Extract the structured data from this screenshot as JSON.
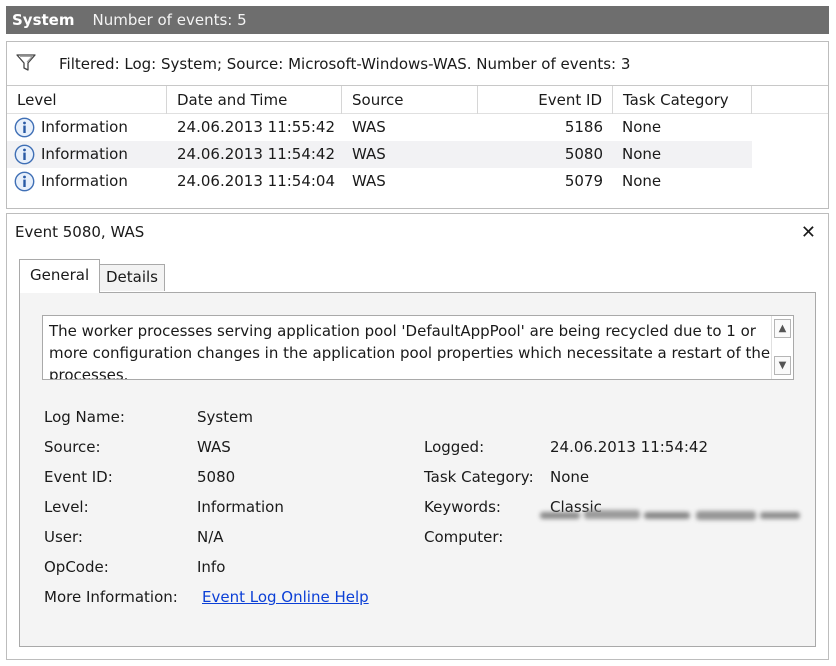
{
  "header": {
    "title": "System",
    "event_count": "Number of events: 5"
  },
  "filter": {
    "text": "Filtered: Log: System; Source: Microsoft-Windows-WAS. Number of events: 3",
    "icon": "filter-icon"
  },
  "table": {
    "columns": [
      "Level",
      "Date and Time",
      "Source",
      "Event ID",
      "Task Category"
    ],
    "rows": [
      {
        "level": "Information",
        "datetime": "24.06.2013 11:55:42",
        "source": "WAS",
        "event_id": "5186",
        "task_category": "None"
      },
      {
        "level": "Information",
        "datetime": "24.06.2013 11:54:42",
        "source": "WAS",
        "event_id": "5080",
        "task_category": "None"
      },
      {
        "level": "Information",
        "datetime": "24.06.2013 11:54:04",
        "source": "WAS",
        "event_id": "5079",
        "task_category": "None"
      }
    ]
  },
  "event": {
    "title": "Event 5080, WAS",
    "tabs": [
      "General",
      "Details"
    ],
    "description": "The worker processes serving application pool 'DefaultAppPool' are being recycled due to 1 or more configuration changes in the application pool properties which necessitate a restart of the processes.",
    "labels": {
      "log_name": "Log Name:",
      "source": "Source:",
      "event_id": "Event ID:",
      "level": "Level:",
      "user": "User:",
      "opcode": "OpCode:",
      "more_info": "More Information:",
      "logged": "Logged:",
      "task_category": "Task Category:",
      "keywords": "Keywords:",
      "computer": "Computer:"
    },
    "values": {
      "log_name": "System",
      "source": "WAS",
      "event_id": "5080",
      "level": "Information",
      "user": "N/A",
      "opcode": "Info",
      "more_info_link": "Event Log Online Help",
      "logged": "24.06.2013 11:54:42",
      "task_category": "None",
      "keywords": "Classic"
    }
  },
  "colors": {
    "header_bg": "#6e6e6e",
    "link": "#0b3fd6",
    "selected_row": "#f2f2f4"
  }
}
